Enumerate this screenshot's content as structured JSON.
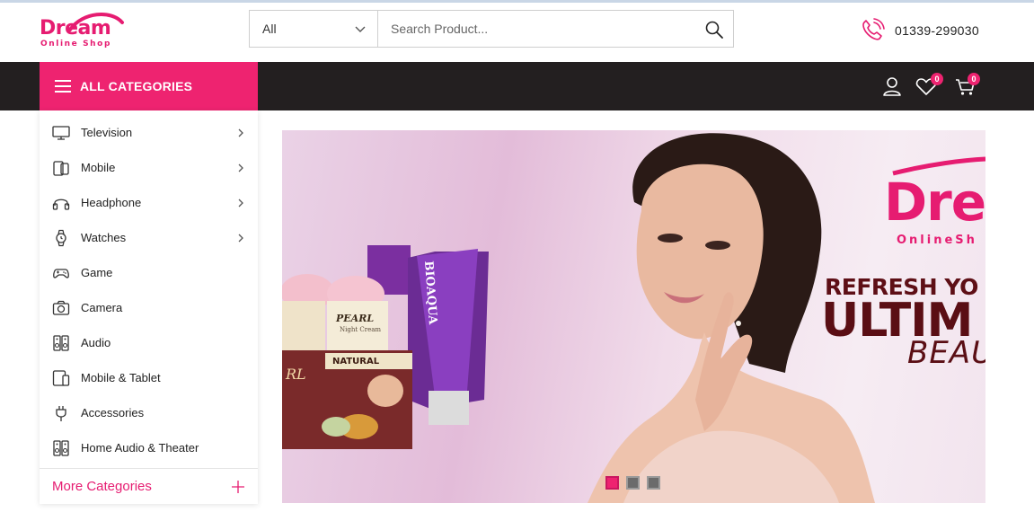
{
  "header": {
    "logo": {
      "main": "Dream",
      "sub": "Online Shop"
    },
    "search": {
      "category_selected": "All",
      "placeholder": "Search Product..."
    },
    "phone": "01339-299030"
  },
  "nav": {
    "all_categories_label": "ALL CATEGORIES",
    "wishlist_count": "0",
    "cart_count": "0",
    "icons": [
      "user-icon",
      "heart-icon",
      "cart-icon"
    ]
  },
  "categories": {
    "items": [
      {
        "label": "Television",
        "icon": "television-icon",
        "has_submenu": true
      },
      {
        "label": "Mobile",
        "icon": "mobile-icon",
        "has_submenu": true
      },
      {
        "label": "Headphone",
        "icon": "headphone-icon",
        "has_submenu": true
      },
      {
        "label": "Watches",
        "icon": "watch-icon",
        "has_submenu": true
      },
      {
        "label": "Game",
        "icon": "gamepad-icon",
        "has_submenu": false
      },
      {
        "label": "Camera",
        "icon": "camera-icon",
        "has_submenu": false
      },
      {
        "label": "Audio",
        "icon": "speaker-icon",
        "has_submenu": false
      },
      {
        "label": "Mobile & Tablet",
        "icon": "tablet-icon",
        "has_submenu": false
      },
      {
        "label": "Accessories",
        "icon": "plug-icon",
        "has_submenu": false
      },
      {
        "label": "Home Audio & Theater",
        "icon": "speaker-icon",
        "has_submenu": false
      }
    ],
    "more_label": "More Categories"
  },
  "banner": {
    "brand_main": "Dre",
    "brand_sub": "OnlineSh",
    "headline_1": "REFRESH YO",
    "headline_2": "ULTIM",
    "headline_3": "BEAU",
    "products": {
      "tube_brand": "BIOAQUA",
      "jar_label": "PEARL",
      "jar_sub": "Night Cream",
      "box_label": "NATURAL",
      "box_brand": "RL"
    },
    "slide_count": 3,
    "active_slide": 1
  },
  "colors": {
    "brand_pink": "#ee2370",
    "nav_dark": "#231f20",
    "headline": "#5a0e14"
  }
}
